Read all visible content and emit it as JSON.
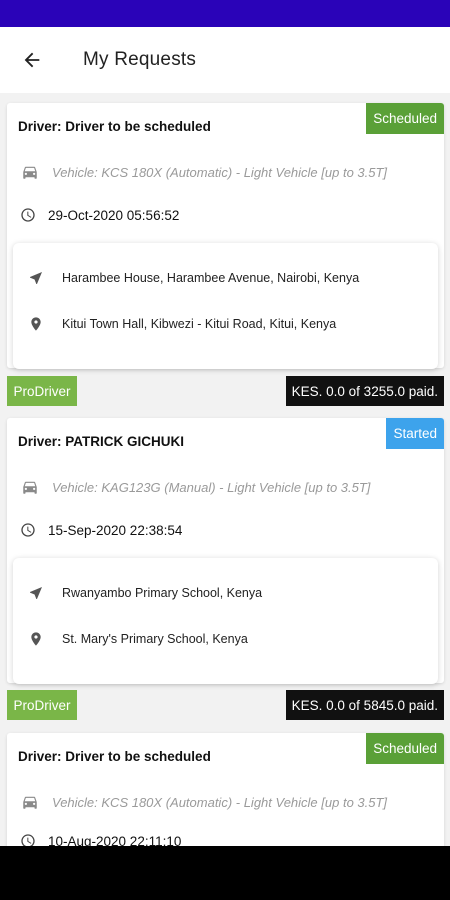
{
  "colors": {
    "status_bar": "#2a03b8",
    "scheduled": "#5aa037",
    "started": "#3da3ec",
    "pro_tag": "#7ab648",
    "paid_tag": "#111111"
  },
  "header": {
    "back_icon": "arrow-left-icon",
    "title": "My Requests"
  },
  "requests": [
    {
      "driver": "Driver: Driver to be scheduled",
      "status": "Scheduled",
      "vehicle": "Vehicle: KCS 180X (Automatic) - Light Vehicle [up to 3.5T]",
      "datetime": "29-Oct-2020 05:56:52",
      "pickup": "Harambee House, Harambee Avenue, Nairobi, Kenya",
      "dropoff": "Kitui Town Hall, Kibwezi - Kitui Road, Kitui, Kenya",
      "tag": "ProDriver",
      "payment": "KES. 0.0 of 3255.0 paid."
    },
    {
      "driver": "Driver: PATRICK  GICHUKI",
      "status": "Started",
      "vehicle": "Vehicle: KAG123G (Manual) - Light Vehicle [up to 3.5T]",
      "datetime": "15-Sep-2020 22:38:54",
      "pickup": "Rwanyambo Primary School, Kenya",
      "dropoff": "St. Mary's Primary School, Kenya",
      "tag": "ProDriver",
      "payment": "KES. 0.0 of 5845.0 paid."
    },
    {
      "driver": "Driver: Driver to be scheduled",
      "status": "Scheduled",
      "vehicle": "Vehicle: KCS 180X (Automatic) - Light Vehicle [up to 3.5T]",
      "datetime": "10-Aug-2020 22:11:10"
    }
  ]
}
